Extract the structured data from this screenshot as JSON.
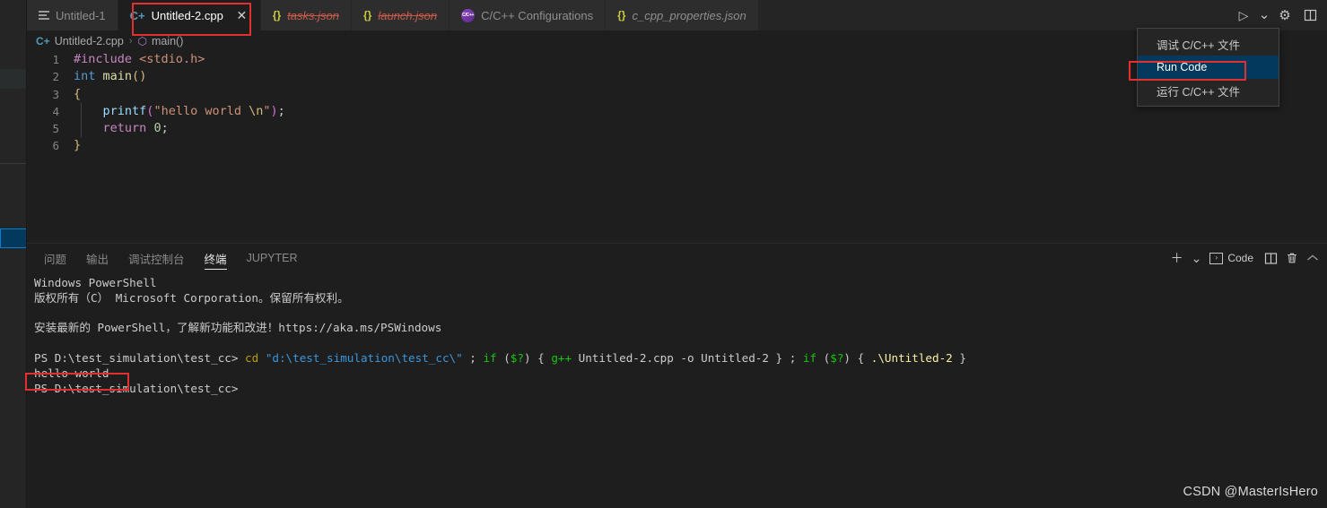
{
  "window": {
    "title": "Visual Studio Code"
  },
  "tabs": [
    {
      "label": "Untitled-1",
      "icon": "lines-icon",
      "active": false,
      "strikethrough": false,
      "italic": false,
      "closable": false
    },
    {
      "label": "Untitled-2.cpp",
      "icon": "cpp-file-icon",
      "active": true,
      "strikethrough": false,
      "italic": false,
      "closable": true,
      "close_glyph": "✕"
    },
    {
      "label": "tasks.json",
      "icon": "json-braces-icon",
      "active": false,
      "strikethrough": true,
      "italic": true,
      "closable": false
    },
    {
      "label": "launch.json",
      "icon": "json-braces-icon",
      "active": false,
      "strikethrough": true,
      "italic": true,
      "closable": false
    },
    {
      "label": "C/C++ Configurations",
      "icon": "cpptools-badge-icon",
      "badge_text": "C/C++",
      "active": false,
      "strikethrough": false,
      "italic": false,
      "closable": false
    },
    {
      "label": "c_cpp_properties.json",
      "icon": "json-braces-icon",
      "active": false,
      "strikethrough": false,
      "italic": true,
      "closable": false
    }
  ],
  "tab_actions": [
    {
      "name": "run-button",
      "glyph": "▷"
    },
    {
      "name": "run-dropdown-chevron",
      "glyph": "⌄"
    },
    {
      "name": "settings-gear-icon",
      "glyph": "⚙"
    },
    {
      "name": "split-editor-icon",
      "glyph": "▯"
    }
  ],
  "breadcrumb": {
    "file_icon": "C+",
    "file": "Untitled-2.cpp",
    "separator": "›",
    "symbol_icon": "⬡",
    "symbol": "main()"
  },
  "editor": {
    "language": "cpp",
    "lines": [
      {
        "num": "1",
        "tokens": [
          {
            "t": "#include",
            "c": "c-pre"
          },
          {
            "t": " ",
            "c": "c-pl"
          },
          {
            "t": "<stdio.h>",
            "c": "c-inc"
          }
        ]
      },
      {
        "num": "2",
        "tokens": [
          {
            "t": "int",
            "c": "c-key"
          },
          {
            "t": " ",
            "c": "c-pl"
          },
          {
            "t": "main",
            "c": "c-fn"
          },
          {
            "t": "(",
            "c": "c-br1"
          },
          {
            "t": ")",
            "c": "c-br1"
          }
        ]
      },
      {
        "num": "3",
        "tokens": [
          {
            "t": "{",
            "c": "c-br1"
          }
        ]
      },
      {
        "num": "4",
        "tokens": [
          {
            "t": "    ",
            "c": "c-pl"
          },
          {
            "t": "printf",
            "c": "c-id"
          },
          {
            "t": "(",
            "c": "c-br2"
          },
          {
            "t": "\"hello world ",
            "c": "c-str"
          },
          {
            "t": "\\n",
            "c": "c-esc"
          },
          {
            "t": "\"",
            "c": "c-str"
          },
          {
            "t": ")",
            "c": "c-br2"
          },
          {
            "t": ";",
            "c": "c-pl"
          }
        ]
      },
      {
        "num": "5",
        "tokens": [
          {
            "t": "    ",
            "c": "c-pl"
          },
          {
            "t": "return",
            "c": "c-kw"
          },
          {
            "t": " ",
            "c": "c-pl"
          },
          {
            "t": "0",
            "c": "c-num"
          },
          {
            "t": ";",
            "c": "c-pl"
          }
        ]
      },
      {
        "num": "6",
        "tokens": [
          {
            "t": "}",
            "c": "c-br1"
          }
        ]
      }
    ]
  },
  "context_menu": {
    "items": [
      {
        "label": "调试 C/C++ 文件",
        "selected": false
      },
      {
        "label": "Run Code",
        "selected": true
      },
      {
        "label": "运行 C/C++ 文件",
        "selected": false
      }
    ]
  },
  "panel": {
    "tabs": [
      {
        "label": "问题",
        "active": false
      },
      {
        "label": "输出",
        "active": false
      },
      {
        "label": "调试控制台",
        "active": false
      },
      {
        "label": "终端",
        "active": true
      },
      {
        "label": "JUPYTER",
        "active": false
      }
    ],
    "actions": [
      {
        "name": "new-terminal-plus-icon",
        "glyph": "＋"
      },
      {
        "name": "terminal-profile-chevron-icon",
        "glyph": "⌄"
      },
      {
        "name": "terminal-selector-code",
        "glyph": "›",
        "label": "Code"
      },
      {
        "name": "split-terminal-icon",
        "glyph": "▯"
      },
      {
        "name": "kill-terminal-trash-icon",
        "glyph": "🗑"
      },
      {
        "name": "collapse-panel-chevron-up-icon",
        "glyph": "⌃"
      }
    ]
  },
  "terminal": {
    "lines": [
      {
        "type": "text",
        "segs": [
          {
            "t": "Windows PowerShell",
            "c": "t-white"
          }
        ]
      },
      {
        "type": "text",
        "segs": [
          {
            "t": "版权所有（C） Microsoft Corporation。保留所有权利。",
            "c": "t-white"
          }
        ]
      },
      {
        "type": "blank"
      },
      {
        "type": "text",
        "segs": [
          {
            "t": "安装最新的 PowerShell，了解新功能和改进！https://aka.ms/PSWindows",
            "c": "t-white"
          }
        ]
      },
      {
        "type": "blank"
      },
      {
        "type": "text",
        "segs": [
          {
            "t": "PS D:\\test_simulation\\test_cc> ",
            "c": "t-white"
          },
          {
            "t": "cd",
            "c": "t-yellow"
          },
          {
            "t": " ",
            "c": "t-white"
          },
          {
            "t": "\"d:\\test_simulation\\test_cc\\\"",
            "c": "t-cyan"
          },
          {
            "t": " ; ",
            "c": "t-white"
          },
          {
            "t": "if",
            "c": "t-green"
          },
          {
            "t": " (",
            "c": "t-white"
          },
          {
            "t": "$?",
            "c": "t-green"
          },
          {
            "t": ") { ",
            "c": "t-white"
          },
          {
            "t": "g++",
            "c": "t-green"
          },
          {
            "t": " Untitled-2.cpp ",
            "c": "t-white"
          },
          {
            "t": "-o",
            "c": "t-grey"
          },
          {
            "t": " Untitled-2 } ; ",
            "c": "t-white"
          },
          {
            "t": "if",
            "c": "t-green"
          },
          {
            "t": " (",
            "c": "t-white"
          },
          {
            "t": "$?",
            "c": "t-green"
          },
          {
            "t": ") { ",
            "c": "t-white"
          },
          {
            "t": ".\\Untitled-2",
            "c": "t-byellow"
          },
          {
            "t": " }",
            "c": "t-white"
          }
        ]
      },
      {
        "type": "text",
        "segs": [
          {
            "t": "hello world",
            "c": "t-white"
          }
        ]
      },
      {
        "type": "text",
        "segs": [
          {
            "t": "PS D:\\test_simulation\\test_cc>",
            "c": "t-white"
          }
        ]
      }
    ]
  },
  "annotations": [
    {
      "name": "annotation-active-tab",
      "color": "#e03030"
    },
    {
      "name": "annotation-run-code-item",
      "color": "#e03030"
    },
    {
      "name": "annotation-hello-world-output",
      "color": "#e03030"
    }
  ],
  "watermark": {
    "text": "CSDN @MasterIsHero"
  }
}
